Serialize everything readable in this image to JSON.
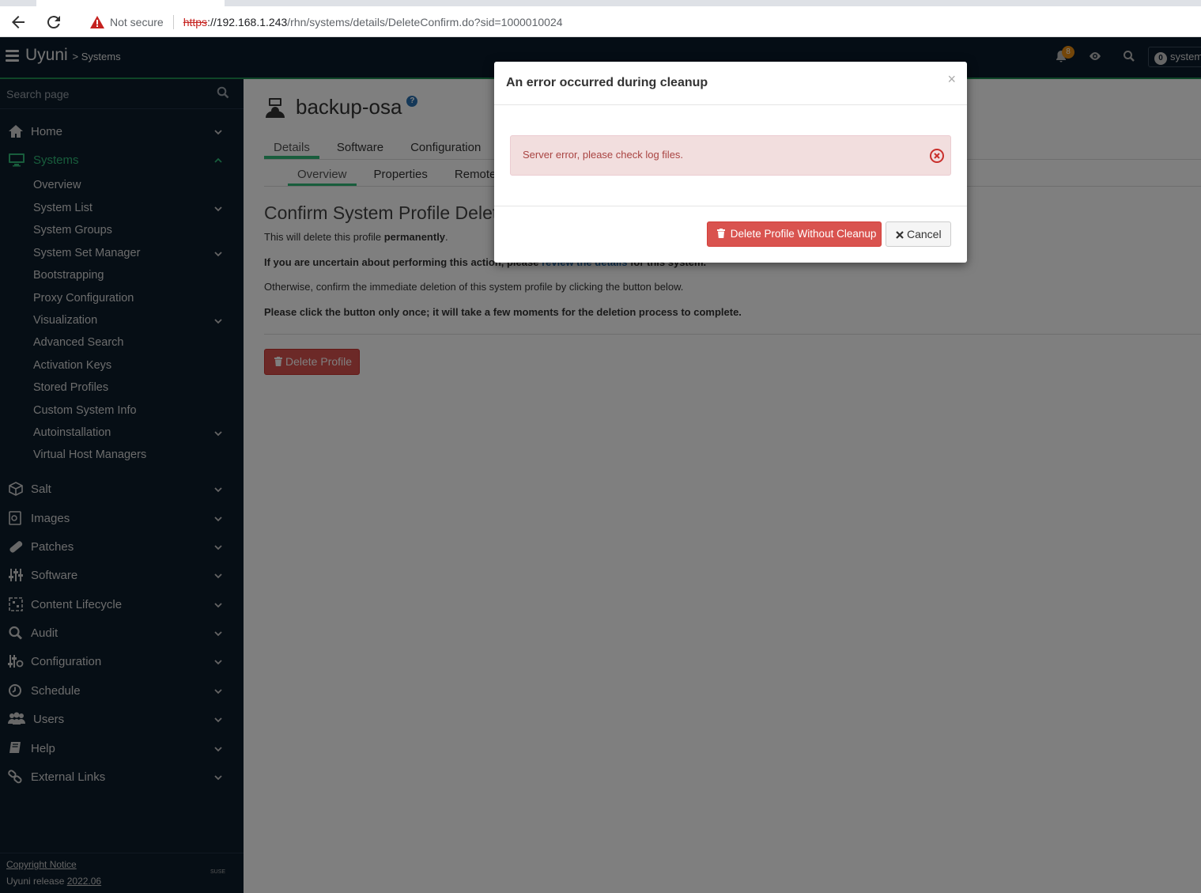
{
  "browser": {
    "not_secure": "Not secure",
    "url_scheme": "https",
    "url_host": "://192.168.1.243",
    "url_path": "/rhn/systems/details/DeleteConfirm.do?sid=1000010024"
  },
  "header": {
    "brand": "Uyuni",
    "breadcrumb": "> Systems",
    "notification_count": "8",
    "systems_selected": "0",
    "systems_label": "systems"
  },
  "sidebar": {
    "search_placeholder": "Search page",
    "items": [
      {
        "label": "Home",
        "icon": "home-icon"
      },
      {
        "label": "Systems",
        "icon": "desktop-icon",
        "active": true
      },
      {
        "label": "Salt",
        "icon": "cube-icon"
      },
      {
        "label": "Images",
        "icon": "images-icon"
      },
      {
        "label": "Patches",
        "icon": "bandage-icon"
      },
      {
        "label": "Software",
        "icon": "sliders-icon"
      },
      {
        "label": "Content Lifecycle",
        "icon": "lifecycle-icon"
      },
      {
        "label": "Audit",
        "icon": "search-icon"
      },
      {
        "label": "Configuration",
        "icon": "config-icon"
      },
      {
        "label": "Schedule",
        "icon": "clock-icon"
      },
      {
        "label": "Users",
        "icon": "users-icon"
      },
      {
        "label": "Help",
        "icon": "book-icon"
      },
      {
        "label": "External Links",
        "icon": "link-icon"
      }
    ],
    "systems_sub": [
      "Overview",
      "System List",
      "System Groups",
      "System Set Manager",
      "Bootstrapping",
      "Proxy Configuration",
      "Visualization",
      "Advanced Search",
      "Activation Keys",
      "Stored Profiles",
      "Custom System Info",
      "Autoinstallation",
      "Virtual Host Managers"
    ],
    "footer_copyright": "Copyright Notice",
    "footer_release_prefix": "Uyuni release ",
    "footer_release_version": "2022.06",
    "footer_vendor": "SUSE"
  },
  "main": {
    "title": "backup-osa",
    "help_icon": "?",
    "tabs": [
      "Details",
      "Software",
      "Configuration"
    ],
    "subtabs": [
      "Overview",
      "Properties",
      "Remote C"
    ],
    "section_title": "Confirm System Profile Deletion",
    "line1_prefix": "This will delete this profile ",
    "line1_bold": "permanently",
    "line1_suffix": ".",
    "line2_prefix": "If you are uncertain about performing this action, please ",
    "line2_link": "review the details",
    "line2_suffix": " for this system.",
    "line3": "Otherwise, confirm the immediate deletion of this system profile by clicking the button below.",
    "line4": "Please click the button only once; it will take a few moments for the deletion process to complete.",
    "delete_button": "Delete Profile"
  },
  "modal": {
    "title": "An error occurred during cleanup",
    "close": "×",
    "alert_message": "Server error, please check log files.",
    "delete_without_cleanup": "Delete Profile Without Cleanup",
    "cancel": "Cancel"
  },
  "colors": {
    "header_bg": "#0a1b2a",
    "sidebar_bg": "#0c1c2b",
    "accent_green": "#30ba78",
    "danger": "#d9534f",
    "alert_bg": "#f2dede",
    "alert_text": "#a94442",
    "badge_orange": "#e88d12",
    "link_blue": "#2b71b1"
  }
}
